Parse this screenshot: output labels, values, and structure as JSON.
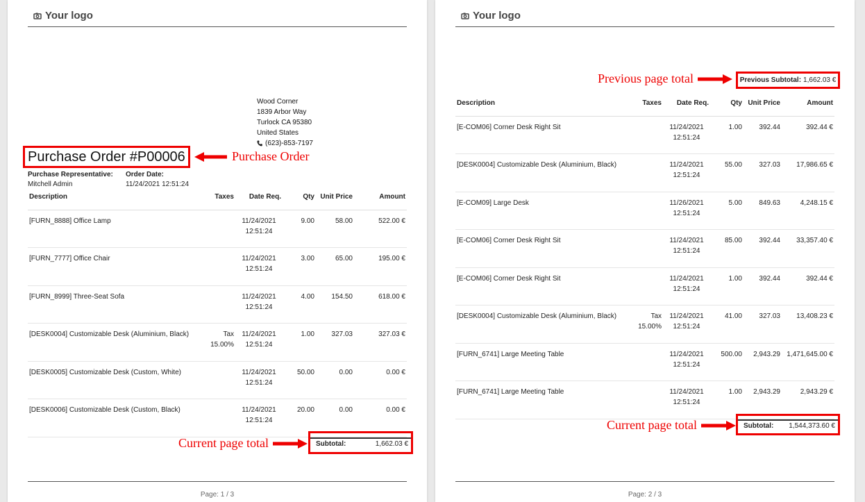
{
  "logo_text": "Your logo",
  "vendor": {
    "name": "Wood Corner",
    "street": "1839 Arbor Way",
    "city": "Turlock CA 95380",
    "country": "United States",
    "phone": "(623)-853-7197"
  },
  "title": "Purchase Order #P00006",
  "representative_label": "Purchase Representative:",
  "representative": "Mitchell Admin",
  "order_date_label": "Order Date:",
  "order_date": "11/24/2021 12:51:24",
  "columns": [
    "Description",
    "Taxes",
    "Date Req.",
    "Qty",
    "Unit Price",
    "Amount"
  ],
  "page1_lines": [
    {
      "desc": "[FURN_8888] Office Lamp",
      "tax": "",
      "date": "11/24/2021 12:51:24",
      "qty": "9.00",
      "price": "58.00",
      "amount": "522.00 €"
    },
    {
      "desc": "[FURN_7777] Office Chair",
      "tax": "",
      "date": "11/24/2021 12:51:24",
      "qty": "3.00",
      "price": "65.00",
      "amount": "195.00 €"
    },
    {
      "desc": "[FURN_8999] Three-Seat Sofa",
      "tax": "",
      "date": "11/24/2021 12:51:24",
      "qty": "4.00",
      "price": "154.50",
      "amount": "618.00 €"
    },
    {
      "desc": "[DESK0004] Customizable Desk (Aluminium, Black)",
      "tax": "Tax 15.00%",
      "date": "11/24/2021 12:51:24",
      "qty": "1.00",
      "price": "327.03",
      "amount": "327.03 €"
    },
    {
      "desc": "[DESK0005] Customizable Desk (Custom, White)",
      "tax": "",
      "date": "11/24/2021 12:51:24",
      "qty": "50.00",
      "price": "0.00",
      "amount": "0.00 €"
    },
    {
      "desc": "[DESK0006] Customizable Desk (Custom, Black)",
      "tax": "",
      "date": "11/24/2021 12:51:24",
      "qty": "20.00",
      "price": "0.00",
      "amount": "0.00 €"
    }
  ],
  "page2_lines": [
    {
      "desc": "[E-COM06] Corner Desk Right Sit",
      "tax": "",
      "date": "11/24/2021 12:51:24",
      "qty": "1.00",
      "price": "392.44",
      "amount": "392.44 €"
    },
    {
      "desc": "[DESK0004] Customizable Desk (Aluminium, Black)",
      "tax": "",
      "date": "11/24/2021 12:51:24",
      "qty": "55.00",
      "price": "327.03",
      "amount": "17,986.65 €"
    },
    {
      "desc": "[E-COM09] Large Desk",
      "tax": "",
      "date": "11/26/2021 12:51:24",
      "qty": "5.00",
      "price": "849.63",
      "amount": "4,248.15 €"
    },
    {
      "desc": "[E-COM06] Corner Desk Right Sit",
      "tax": "",
      "date": "11/24/2021 12:51:24",
      "qty": "85.00",
      "price": "392.44",
      "amount": "33,357.40 €"
    },
    {
      "desc": "[E-COM06] Corner Desk Right Sit",
      "tax": "",
      "date": "11/24/2021 12:51:24",
      "qty": "1.00",
      "price": "392.44",
      "amount": "392.44 €"
    },
    {
      "desc": "[DESK0004] Customizable Desk (Aluminium, Black)",
      "tax": "Tax 15.00%",
      "date": "11/24/2021 12:51:24",
      "qty": "41.00",
      "price": "327.03",
      "amount": "13,408.23 €"
    },
    {
      "desc": "[FURN_6741] Large Meeting Table",
      "tax": "",
      "date": "11/24/2021 12:51:24",
      "qty": "500.00",
      "price": "2,943.29",
      "amount": "1,471,645.00 €"
    },
    {
      "desc": "[FURN_6741] Large Meeting Table",
      "tax": "",
      "date": "11/24/2021 12:51:24",
      "qty": "1.00",
      "price": "2,943.29",
      "amount": "2,943.29 €"
    }
  ],
  "subtotal_label": "Subtotal:",
  "page1_subtotal": "1,662.03 €",
  "prev_subtotal_label": "Previous Subtotal:",
  "prev_subtotal": "1,662.03 €",
  "page2_subtotal": "1,544,373.60 €",
  "annotations": {
    "purchase_order": "Purchase Order",
    "current_total": "Current page total",
    "previous_total": "Previous page total"
  },
  "page1_footer": "Page: 1 / 3",
  "page2_footer": "Page: 2 / 3",
  "annotation_color": "#e00000"
}
